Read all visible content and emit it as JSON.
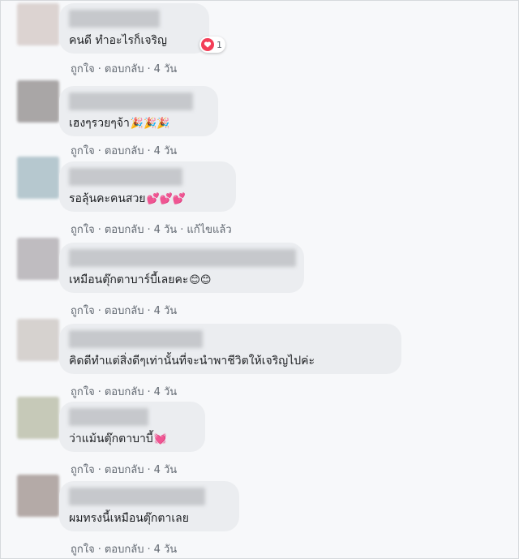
{
  "actions": {
    "like": "ถูกใจ",
    "reply": "ตอบกลับ",
    "separator": "·",
    "edited": "แก้ไขแล้ว"
  },
  "comments": [
    {
      "text": "คนดี ทำอะไรก็เจริญ",
      "emoji": "",
      "time": "4 วัน",
      "reactions": "1"
    },
    {
      "text": "เฮงๆรวยๆจ้า",
      "emoji": "🎉🎉🎉",
      "time": "4 วัน"
    },
    {
      "text": "รอลุ้นคะคนสวย",
      "emoji": "💕💕💕",
      "time": "4 วัน"
    },
    {
      "text": "เหมือนตุ๊กตาบาร์บี้เลยคะ",
      "emoji": "😊😊",
      "time": "4 วัน"
    },
    {
      "text": "คิดดีทำแต่สิ่งดีๆเท่านั้นที่จะนำพาชีวิตให้เจริญไปค่ะ",
      "emoji": "",
      "time": "4 วัน"
    },
    {
      "text": "ว่าแม้นตุ๊กตาบาบี้",
      "emoji": "💓",
      "time": "4 วัน"
    },
    {
      "text": "ผมทรงนี้เหมือนตุ๊กตาเลย",
      "emoji": "",
      "time": "4 วัน"
    }
  ],
  "colors": {
    "bubble": "#ebedf0",
    "meta_text": "#606770",
    "love_reaction": "#f33e58"
  }
}
